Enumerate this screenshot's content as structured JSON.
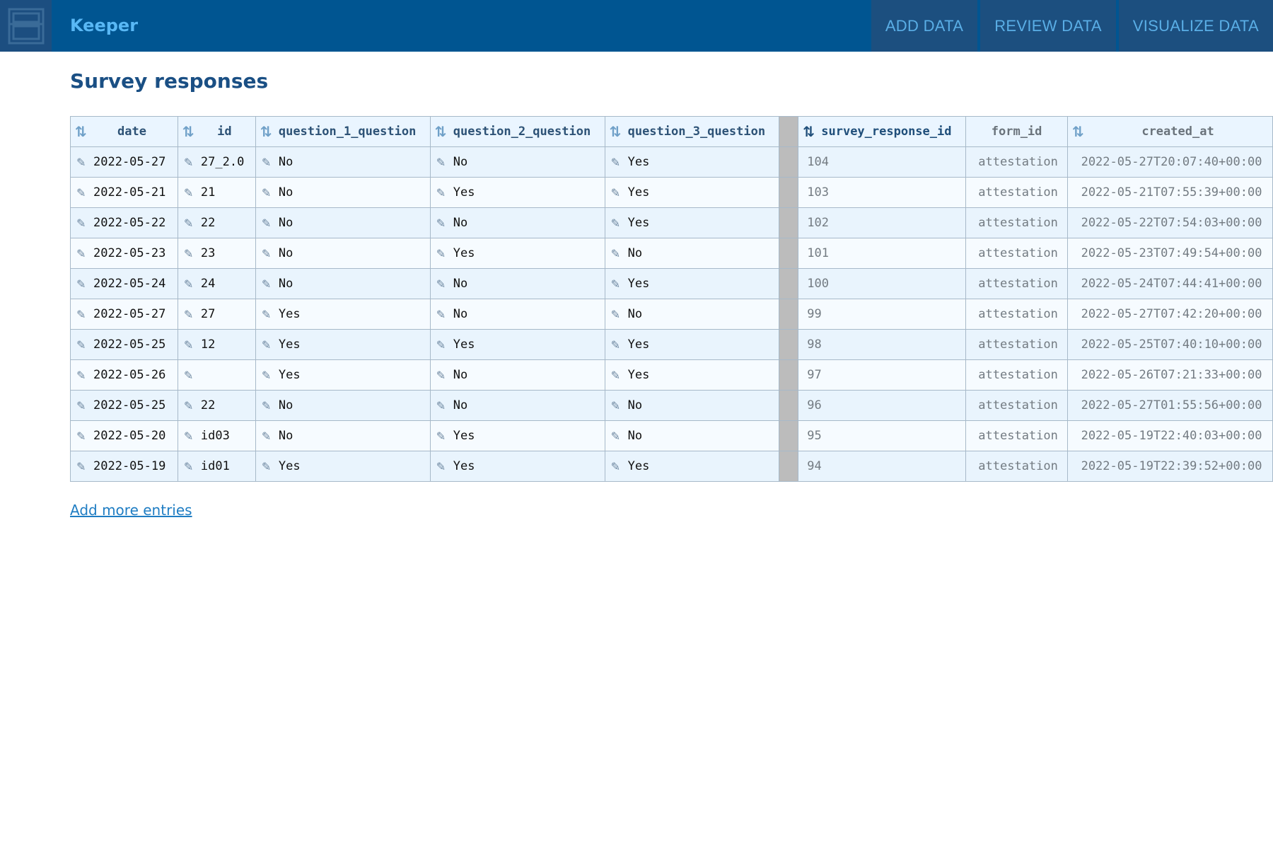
{
  "header": {
    "logo_icon": "keeper-logo-icon",
    "brand": "Keeper",
    "nav": [
      "ADD DATA",
      "REVIEW DATA",
      "VISUALIZE DATA"
    ]
  },
  "page_title": "Survey responses",
  "table": {
    "columns": [
      {
        "label": "date",
        "sortable": true,
        "sort_state": "none"
      },
      {
        "label": "id",
        "sortable": true,
        "sort_state": "none"
      },
      {
        "label": "question_1_question",
        "sortable": true,
        "sort_state": "none"
      },
      {
        "label": "question_2_question",
        "sortable": true,
        "sort_state": "none"
      },
      {
        "label": "question_3_question",
        "sortable": true,
        "sort_state": "none"
      },
      {
        "label": "survey_response_id",
        "sortable": true,
        "sort_state": "descending"
      },
      {
        "label": "form_id",
        "sortable": false,
        "sort_state": "none"
      },
      {
        "label": "created_at",
        "sortable": true,
        "sort_state": "none"
      }
    ],
    "rows": [
      {
        "date": "2022-05-27",
        "id": "27_2.0",
        "q1": "No",
        "q2": "No",
        "q3": "Yes",
        "survey_response_id": "104",
        "form_id": "attestation",
        "created_at": "2022-05-27T20:07:40+00:00"
      },
      {
        "date": "2022-05-21",
        "id": "21",
        "q1": "No",
        "q2": "Yes",
        "q3": "Yes",
        "survey_response_id": "103",
        "form_id": "attestation",
        "created_at": "2022-05-21T07:55:39+00:00"
      },
      {
        "date": "2022-05-22",
        "id": "22",
        "q1": "No",
        "q2": "No",
        "q3": "Yes",
        "survey_response_id": "102",
        "form_id": "attestation",
        "created_at": "2022-05-22T07:54:03+00:00"
      },
      {
        "date": "2022-05-23",
        "id": "23",
        "q1": "No",
        "q2": "Yes",
        "q3": "No",
        "survey_response_id": "101",
        "form_id": "attestation",
        "created_at": "2022-05-23T07:49:54+00:00"
      },
      {
        "date": "2022-05-24",
        "id": "24",
        "q1": "No",
        "q2": "No",
        "q3": "Yes",
        "survey_response_id": "100",
        "form_id": "attestation",
        "created_at": "2022-05-24T07:44:41+00:00"
      },
      {
        "date": "2022-05-27",
        "id": "27",
        "q1": "Yes",
        "q2": "No",
        "q3": "No",
        "survey_response_id": "99",
        "form_id": "attestation",
        "created_at": "2022-05-27T07:42:20+00:00"
      },
      {
        "date": "2022-05-25",
        "id": "12",
        "q1": "Yes",
        "q2": "Yes",
        "q3": "Yes",
        "survey_response_id": "98",
        "form_id": "attestation",
        "created_at": "2022-05-25T07:40:10+00:00"
      },
      {
        "date": "2022-05-26",
        "id": "",
        "q1": "Yes",
        "q2": "No",
        "q3": "Yes",
        "survey_response_id": "97",
        "form_id": "attestation",
        "created_at": "2022-05-26T07:21:33+00:00"
      },
      {
        "date": "2022-05-25",
        "id": "22",
        "q1": "No",
        "q2": "No",
        "q3": "No",
        "survey_response_id": "96",
        "form_id": "attestation",
        "created_at": "2022-05-27T01:55:56+00:00"
      },
      {
        "date": "2022-05-20",
        "id": "id03",
        "q1": "No",
        "q2": "Yes",
        "q3": "No",
        "survey_response_id": "95",
        "form_id": "attestation",
        "created_at": "2022-05-19T22:40:03+00:00"
      },
      {
        "date": "2022-05-19",
        "id": "id01",
        "q1": "Yes",
        "q2": "Yes",
        "q3": "Yes",
        "survey_response_id": "94",
        "form_id": "attestation",
        "created_at": "2022-05-19T22:39:52+00:00"
      }
    ]
  },
  "add_more_link": "Add more entries",
  "colors": {
    "header_bg": "#005591",
    "brand_text": "#59b8f5",
    "title_text": "#1a4f84",
    "link": "#1f7dc3",
    "row_odd": "#e9f4fd",
    "row_even": "#f6fbff"
  }
}
